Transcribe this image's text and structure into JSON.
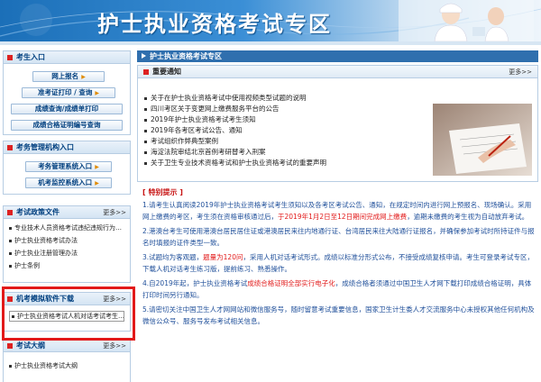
{
  "banner": {
    "title": "护士执业资格考试专区"
  },
  "sidebar": {
    "candidate": {
      "title": "考生入口",
      "buttons": [
        "网上报名",
        "准考证打印 / 查询",
        "成绩查询/成绩单打印",
        "成绩合格证明编号查询"
      ]
    },
    "agency": {
      "title": "考务管理机构入口",
      "buttons": [
        "考务管理系统入口",
        "机考监控系统入口"
      ]
    },
    "policy": {
      "title": "考试政策文件",
      "more": "更多>>",
      "items": [
        "专业技术人员资格考试违纪违规行为…",
        "护士执业资格考试办法",
        "护士执业注册管理办法",
        "护士条例"
      ]
    },
    "software": {
      "title": "机考模拟软件下载",
      "more": "更多>>",
      "items": [
        "护士执业资格考试人机对话考试考生…"
      ]
    },
    "syllabus": {
      "title": "考试大纲",
      "more": "更多>>",
      "items": [
        "护士执业资格考试大纲"
      ]
    }
  },
  "main": {
    "header": "护士执业资格考试专区",
    "notice": {
      "title": "重要通知",
      "more": "更多>>",
      "items": [
        "关于在护士执业资格考试中使用视频类型试题的说明",
        "四川考区关于变更网上缴费服务平台的公告",
        "2019年护士执业资格考试考生须知",
        "2019年各考区考试公告、通知",
        "考试组织作弊典型案例",
        "海淀法院审结北京首例考研替考入刑案",
        "关于卫生专业技术资格考试和护士执业资格考试的重要声明"
      ]
    },
    "tips": {
      "title": "[ 特别提示 ]",
      "p1a": "1.请考生认真阅读2019年护士执业资格考试考生须知以及各考区考试公告、通知，在规定时间内进行网上预报名、现场确认。采用网上缴费的考区，考生须在资格审核通过后，",
      "p1red": "于2019年1月2日至12日期间完成网上缴费",
      "p1b": "，逾期未缴费的考生视为自动放弃考试。",
      "p2": "2.港澳台考生可使用港澳台居民居住证或港澳居民来往内地通行证、台湾居民来往大陆通行证报名，并确保参加考试时所持证件与报名时填报的证件类型一致。",
      "p3a": "3.试题均为客观题，",
      "p3red": "题量为120问",
      "p3b": "，采用人机对话考试形式。成绩以标准分形式公布，不接受成绩复核申请。考生可登录考试专区，下载人机对话考生练习版，提前练习、熟悉操作。",
      "p4a": "4.自2019年起，护士执业资格考试",
      "p4red": "成绩合格证明全部实行电子化",
      "p4b": "，成绩合格者须通过中国卫生人才网下载打印成绩合格证明，具体打印时间另行通知。",
      "p5": "5.请密切关注中国卫生人才网网站和微信服务号，随时留意考试重要信息，国家卫生计生委人才交流服务中心未授权其他任何机构及微信公众号、服务号发布考试相关信息。"
    }
  }
}
